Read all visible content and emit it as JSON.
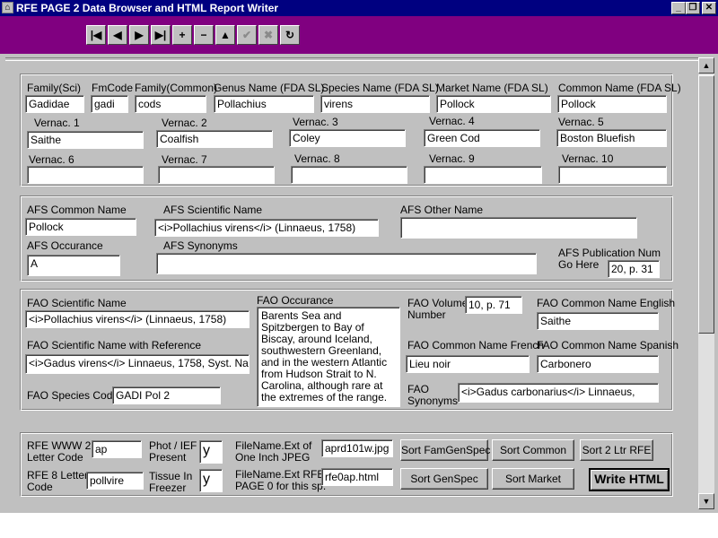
{
  "window": {
    "title": "RFE PAGE 2 Data Browser and HTML Report Writer",
    "app_icon": "app-icon",
    "controls": [
      "_",
      "❐",
      "✕"
    ]
  },
  "toolbar": {
    "buttons": [
      {
        "name": "first-record",
        "glyph": "|◀"
      },
      {
        "name": "prior-record",
        "glyph": "◀"
      },
      {
        "name": "next-record",
        "glyph": "▶"
      },
      {
        "name": "last-record",
        "glyph": "▶|"
      },
      {
        "name": "insert-record",
        "glyph": "+"
      },
      {
        "name": "delete-record",
        "glyph": "−"
      },
      {
        "name": "edit-record",
        "glyph": "▲"
      },
      {
        "name": "post-edit",
        "glyph": "✔"
      },
      {
        "name": "cancel-edit",
        "glyph": "✖"
      },
      {
        "name": "refresh-data",
        "glyph": "↻"
      }
    ]
  },
  "taxonomy": {
    "family_sci": {
      "label": "Family(Sci)",
      "value": "Gadidae"
    },
    "fm_code": {
      "label": "FmCode",
      "value": "gadi"
    },
    "family_common": {
      "label": "Family(Common)",
      "value": "cods"
    },
    "genus_name": {
      "label": "Genus Name (FDA SL)",
      "value": "Pollachius"
    },
    "species_name": {
      "label": "Species Name (FDA SL)",
      "value": "virens"
    },
    "market_name": {
      "label": "Market Name (FDA SL)",
      "value": "Pollock"
    },
    "common_name": {
      "label": "Common Name (FDA SL)",
      "value": "Pollock"
    },
    "vernac": [
      {
        "label": "Vernac. 1",
        "value": "Saithe"
      },
      {
        "label": "Vernac. 2",
        "value": "Coalfish"
      },
      {
        "label": "Vernac. 3",
        "value": "Coley"
      },
      {
        "label": "Vernac. 4",
        "value": "Green Cod"
      },
      {
        "label": "Vernac. 5",
        "value": "Boston Bluefish"
      },
      {
        "label": "Vernac. 6",
        "value": ""
      },
      {
        "label": "Vernac. 7",
        "value": ""
      },
      {
        "label": "Vernac. 8",
        "value": ""
      },
      {
        "label": "Vernac. 9",
        "value": ""
      },
      {
        "label": "Vernac. 10",
        "value": ""
      }
    ]
  },
  "afs": {
    "common_name": {
      "label": "AFS Common Name",
      "value": "Pollock"
    },
    "scientific_name": {
      "label": "AFS Scientific Name",
      "value": "<i>Pollachius virens</i> (Linnaeus, 1758)"
    },
    "other_name": {
      "label": "AFS Other Name",
      "value": ""
    },
    "occurance": {
      "label": "AFS Occurance",
      "value": "A"
    },
    "synonyms": {
      "label": "AFS Synonyms",
      "value": ""
    },
    "publication_num": {
      "label1": "AFS Publication Num",
      "label2": "Go Here",
      "value": "20, p. 31"
    }
  },
  "fao": {
    "scientific_name": {
      "label": "FAO Scientific Name",
      "value": "<i>Pollachius virens</i> (Linnaeus, 1758)"
    },
    "scientific_name_ref": {
      "label": "FAO Scientific Name with Reference",
      "value": "<i>Gadus virens</i> Linnaeus, 1758, Syst. Nat.,"
    },
    "species_code": {
      "label": "FAO Species Code",
      "value": "GADI Pol 2"
    },
    "occurance": {
      "label": "FAO Occurance",
      "value": "Barents Sea and Spitzbergen to Bay of Biscay, around Iceland, southwestern Greenland, and in the western Atlantic from Hudson Strait to N. Carolina, although rare at the extremes of the range."
    },
    "volume_number": {
      "label1": "FAO Volume",
      "label2": "Number",
      "value": "10, p. 71"
    },
    "common_english": {
      "label": "FAO Common Name English",
      "value": "Saithe"
    },
    "common_french": {
      "label": "FAO Common Name French",
      "value": "Lieu noir"
    },
    "common_spanish": {
      "label": "FAO Common Name Spanish",
      "value": "Carbonero"
    },
    "synonyms": {
      "label1": "FAO",
      "label2": "Synonyms",
      "value": "<i>Gadus carbonarius</i> Linnaeus,"
    }
  },
  "rfe": {
    "www2_code": {
      "label1": "RFE WWW 2",
      "label2": "Letter Code",
      "value": "ap"
    },
    "code8": {
      "label1": "RFE 8 Letter",
      "label2": "Code",
      "value": "pollvire"
    },
    "photo_present": {
      "label1": "Phot / IEF",
      "label2": "Present",
      "value": "y"
    },
    "tissue_freezer": {
      "label1": "Tissue In",
      "label2": "Freezer",
      "value": "y"
    },
    "jpeg_filename": {
      "label1": "FileName.Ext of",
      "label2": "One Inch JPEG",
      "value": "aprd101w.jpg"
    },
    "html_filename": {
      "label1": "FileName.Ext RFE",
      "label2": "PAGE 0 for this sp.",
      "value": "rfe0ap.html"
    }
  },
  "buttons": {
    "sort_famgenspec": "Sort FamGenSpec",
    "sort_common": "Sort Common",
    "sort_2ltr": "Sort 2 Ltr RFE",
    "sort_genspec": "Sort GenSpec",
    "sort_market": "Sort Market",
    "write_html": "Write HTML"
  },
  "scrollbar": {
    "up": "▲",
    "down": "▼"
  },
  "colors": {
    "titlebar": "#000080",
    "toolbar": "#800080",
    "face": "#c0c0c0"
  }
}
